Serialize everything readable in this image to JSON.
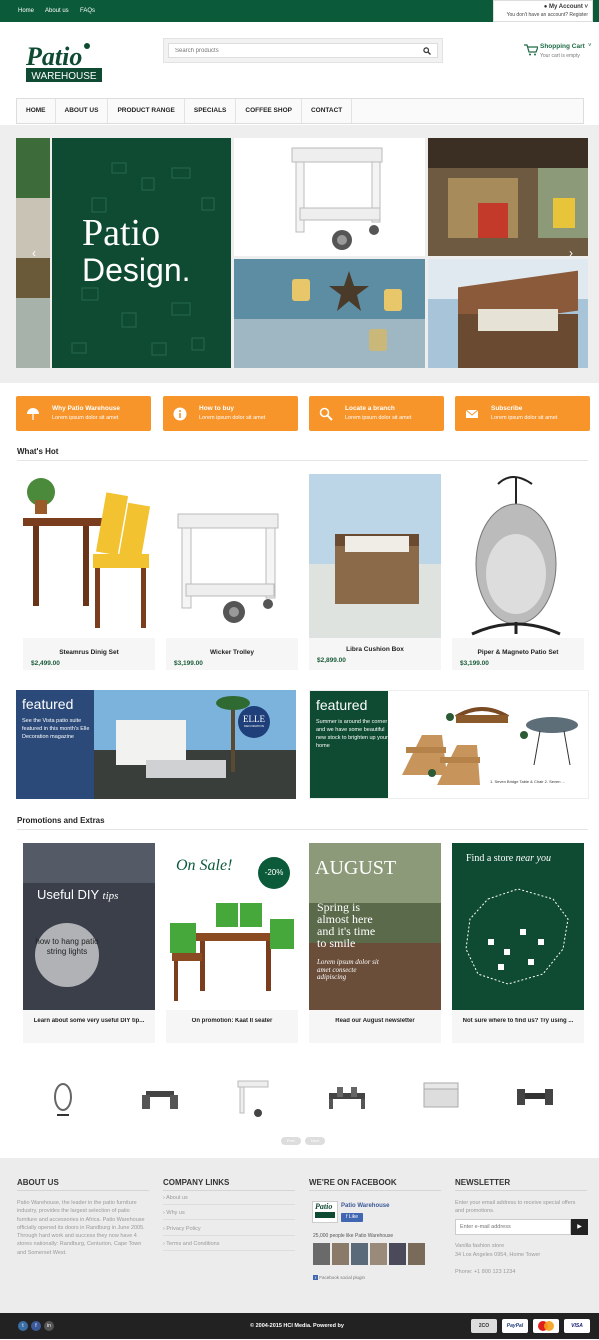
{
  "topbar": {
    "links": [
      "Home",
      "About us",
      "FAQs"
    ],
    "account": "My Account",
    "account_line": "You don't have an account? Register"
  },
  "brand": {
    "logo_top": "Patio",
    "logo_bottom": "WAREHOUSE"
  },
  "search": {
    "placeholder": "Search products"
  },
  "cart": {
    "title": "Shopping Cart",
    "status": "Your cart is empty"
  },
  "nav": [
    "HOME",
    "ABOUT US",
    "PRODUCT RANGE",
    "SPECIALS",
    "COFFEE SHOP",
    "CONTACT"
  ],
  "hero": {
    "line1": "Patio",
    "line2": "Design."
  },
  "features": [
    {
      "title": "Why Patio Warehouse",
      "sub": "Lorem ipsum dolor sit amet",
      "icon": "umbrella-icon"
    },
    {
      "title": "How to buy",
      "sub": "Lorem ipsum dolor sit amet",
      "icon": "info-icon"
    },
    {
      "title": "Locate a branch",
      "sub": "Lorem ipsum dolor sit amet",
      "icon": "search-icon"
    },
    {
      "title": "Subscribe",
      "sub": "Lorem ipsum dolor sit amet",
      "icon": "envelope-icon"
    }
  ],
  "whats_hot": {
    "heading": "What's Hot",
    "products": [
      {
        "name": "Steamrus Dinig Set",
        "price": "$2,499.00"
      },
      {
        "name": "Wicker Trolley",
        "price": "$3,199.00"
      },
      {
        "name": "Libra Cushion Box",
        "price": "$2,899.00"
      },
      {
        "name": "Piper & Magneto Patio Set",
        "price": "$3,199.00"
      }
    ]
  },
  "featured": [
    {
      "title": "featured",
      "text": "See the Vista patio suite featured in this month's Elle Decoration magazine",
      "badge": "ELLE",
      "badge_sub": "DECORATION"
    },
    {
      "title": "featured",
      "text": "Summer is around the corner and we have some beautiful new stock to brighten up your home",
      "caption": "1. Seven Bridge Table & Chair 2. Seven ..."
    }
  ],
  "promotions": {
    "heading": "Promotions and Extras",
    "cards": [
      {
        "caption": "Learn about some very useful DIY tip...",
        "title": "Useful DIY",
        "title_em": "tips",
        "circle": "how to hang patio string lights"
      },
      {
        "caption": "On promotion: Kaat II seater",
        "title": "On Sale!",
        "badge": "-20%"
      },
      {
        "caption": "Read our August newsletter",
        "title": "AUGUST",
        "text": "Spring is almost here and it's time to smile",
        "lorem": "Lorem ipsum dolor sit amet consecte adipiscing"
      },
      {
        "caption": "Not sure where to find us? Try using ...",
        "title": "Find a store",
        "title_em": "near you"
      }
    ]
  },
  "carousel": {
    "prev": "Prev",
    "next": "Next"
  },
  "footer": {
    "about": {
      "heading": "About Us",
      "text": "Patio Warehouse, the leader in the patio furniture industry, provides the largest selection of patio furniture and accessories in Africa. Patio Warehouse officially opened its doors in Randburg in June 2005. Through hard work and success they now have 4 stores nationally: Randburg, Centurion, Cape Town and Somerset West."
    },
    "links": {
      "heading": "Company Links",
      "items": [
        "About us",
        "Why us",
        "Privacy Policy",
        "Terms and Conditions"
      ]
    },
    "facebook": {
      "heading": "We're on Facebook",
      "page": "Patio Warehouse",
      "like": "Like",
      "count": "25,000 people like Patio Warehouse",
      "plugin": "Facebook social plugin"
    },
    "newsletter": {
      "heading": "Newsletter",
      "text": "Enter your email address to receive special offers and promotions.",
      "placeholder": "Enter e-mail address",
      "address1": "Vanilla fashion store",
      "address2": "34 Los Angeles 0954, Home Tower",
      "phone": "Phone: +1 800 123 1234"
    }
  },
  "bottom": {
    "copyright": "© 2004-2015 HCI Media.  Powered by",
    "payments": [
      "2CO",
      "PayPal",
      "Mastercard",
      "VISA"
    ]
  },
  "colors": {
    "green": "#0b5a3a",
    "orange": "#f7942a"
  }
}
